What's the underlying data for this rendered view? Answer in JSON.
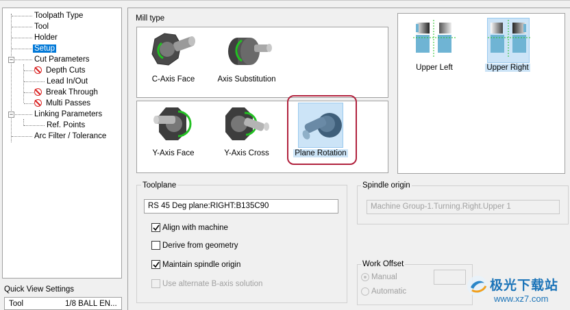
{
  "tree": {
    "items": [
      {
        "label": "Toolpath Type"
      },
      {
        "label": "Tool"
      },
      {
        "label": "Holder"
      },
      {
        "label": "Setup"
      },
      {
        "label": "Cut Parameters"
      },
      {
        "label": "Depth Cuts"
      },
      {
        "label": "Lead In/Out"
      },
      {
        "label": "Break Through"
      },
      {
        "label": "Multi Passes"
      },
      {
        "label": "Linking Parameters"
      },
      {
        "label": "Ref. Points"
      },
      {
        "label": "Arc Filter / Tolerance"
      }
    ],
    "selected": "Setup"
  },
  "quick_view": {
    "label": "Quick View Settings",
    "rows": [
      {
        "key": "Tool",
        "value": "1/8 BALL EN..."
      }
    ]
  },
  "mill_type": {
    "label": "Mill type",
    "options": [
      {
        "label": "C-Axis Face"
      },
      {
        "label": "Axis Substitution"
      },
      {
        "label": "Y-Axis Face"
      },
      {
        "label": "Y-Axis Cross"
      },
      {
        "label": "Plane Rotation"
      }
    ],
    "selected": "Plane Rotation"
  },
  "orientation": {
    "options": [
      {
        "label": "Upper Left"
      },
      {
        "label": "Upper Right"
      }
    ],
    "selected": "Upper Right"
  },
  "toolplane": {
    "label": "Toolplane",
    "value": "RS 45 Deg plane:RIGHT:B135C90",
    "align_with_machine": {
      "label": "Align with machine",
      "checked": true
    },
    "derive_from_geometry": {
      "label": "Derive from geometry",
      "checked": false
    },
    "maintain_spindle_origin": {
      "label": "Maintain spindle origin",
      "checked": true
    },
    "use_alternate_b_axis": {
      "label": "Use alternate B-axis solution",
      "checked": false,
      "disabled": true
    }
  },
  "spindle_origin": {
    "label": "Spindle origin",
    "value": "Machine Group-1.Turning.Right.Upper 1"
  },
  "work_offset": {
    "label": "Work Offset",
    "manual": {
      "label": "Manual",
      "selected": true
    },
    "automatic": {
      "label": "Automatic",
      "selected": false
    }
  },
  "watermark": {
    "text": "极光下载站",
    "url": "www.xz7.com"
  },
  "colors": {
    "accent": "#0078d7",
    "highlight_ring": "#b0203c",
    "selection_bg": "#cce4f7"
  }
}
